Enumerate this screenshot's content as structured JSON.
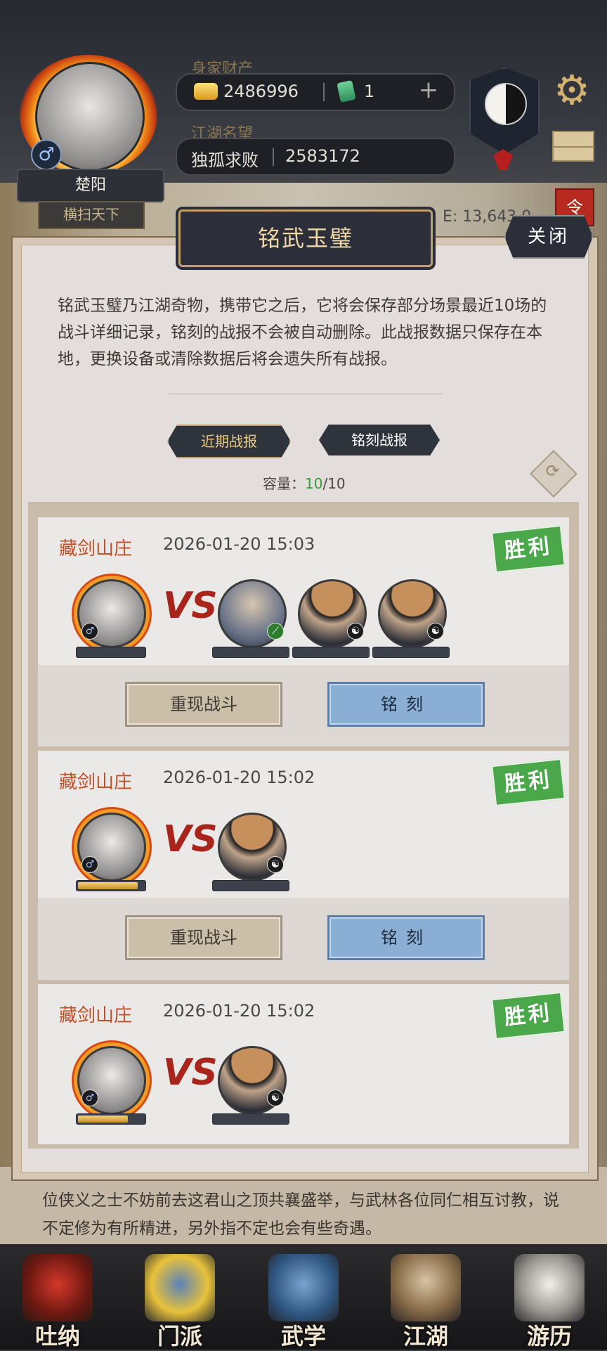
{
  "player": {
    "name": "楚阳",
    "title": "横扫天下",
    "gender_symbol": "♂"
  },
  "wealth": {
    "label": "身家财产",
    "gold": "2486996",
    "jade": "1",
    "add_symbol": "+"
  },
  "fame": {
    "label": "江湖名望",
    "rank_title": "独孤求败",
    "value": "2583172"
  },
  "background": {
    "power_text": "E: 13,643,0",
    "red_tab_char": "令",
    "scroll_text": "位侠义之士不妨前去这君山之顶共襄盛举，与武林各位同仁相互讨教，说不定修为有所精进，另外指不定也会有些奇遇。"
  },
  "modal": {
    "title": "铭武玉璧",
    "close_label": "关闭",
    "description": "铭武玉璧乃江湖奇物，携带它之后，它将会保存部分场景最近10场的战斗详细记录，铭刻的战报不会被自动删除。此战报数据只保存在本地，更换设备或清除数据后将会遗失所有战报。",
    "tabs": [
      "近期战报",
      "铭刻战报"
    ],
    "capacity_label": "容量：",
    "capacity_used": "10",
    "capacity_total": "/10"
  },
  "records": [
    {
      "place": "藏剑山庄",
      "time": "2026-01-20 15:03",
      "result": "胜利",
      "replay_label": "重现战斗",
      "engrave_label": "铭刻",
      "self_hp": 0.0,
      "enemy_count": 3
    },
    {
      "place": "藏剑山庄",
      "time": "2026-01-20 15:02",
      "result": "胜利",
      "replay_label": "重现战斗",
      "engrave_label": "铭刻",
      "self_hp": 0.9,
      "enemy_count": 1
    },
    {
      "place": "藏剑山庄",
      "time": "2026-01-20 15:02",
      "result": "胜利",
      "self_hp": 0.75,
      "enemy_count": 1
    }
  ],
  "vs_text": "VS",
  "nav": [
    {
      "label": "吐纳",
      "icon": "gourd-icon"
    },
    {
      "label": "门派",
      "icon": "banner-icon"
    },
    {
      "label": "武学",
      "icon": "scroll-book-icon"
    },
    {
      "label": "江湖",
      "icon": "straw-hat-icon"
    },
    {
      "label": "游历",
      "icon": "horse-icon"
    }
  ]
}
